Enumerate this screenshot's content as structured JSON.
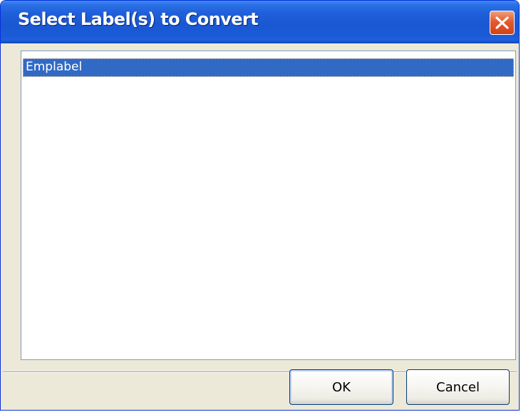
{
  "dialog": {
    "title": "Select Label(s) to Convert"
  },
  "list": {
    "items": [
      {
        "label": "Emplabel",
        "selected": true
      }
    ]
  },
  "buttons": {
    "ok_label": "OK",
    "cancel_label": "Cancel"
  },
  "colors": {
    "titlebar": "#1f5fd9",
    "close_button": "#e35a2e",
    "selection": "#316ac5",
    "dialog_background": "#ece9d8"
  },
  "icons": {
    "close": "close-icon"
  }
}
